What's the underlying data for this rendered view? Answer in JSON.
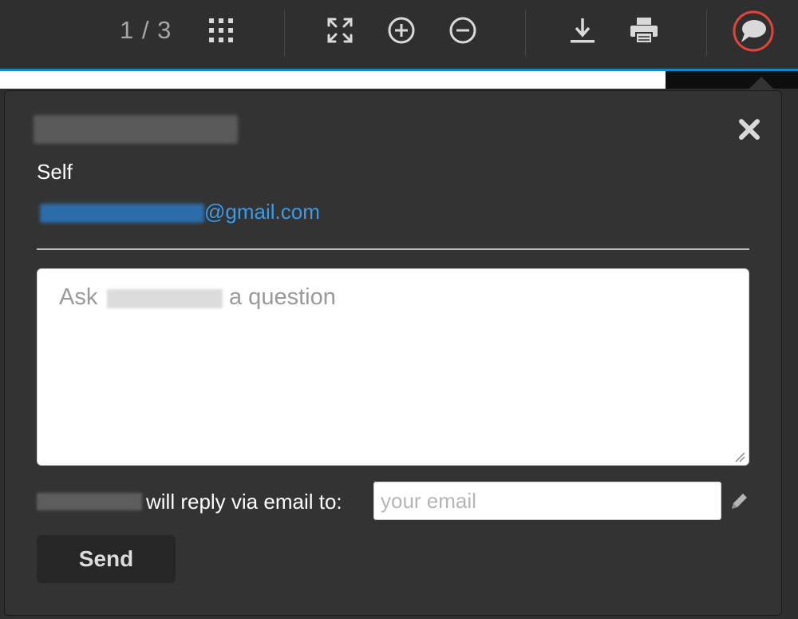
{
  "toolbar": {
    "page_counter": "1 / 3",
    "accent_color": "#0f89c9",
    "buttons": [
      {
        "name": "grid-icon"
      },
      {
        "name": "fullscreen-icon"
      },
      {
        "name": "zoom-in-icon"
      },
      {
        "name": "zoom-out-icon"
      },
      {
        "name": "download-icon"
      },
      {
        "name": "print-icon"
      },
      {
        "name": "comment-icon"
      }
    ],
    "highlight_color": "#e0443b"
  },
  "popover": {
    "relation": "Self",
    "email_visible": "@gmail.com",
    "close_icon": "close-icon",
    "question_prefix": "Ask",
    "question_suffix": "a question",
    "reply_text": "will reply via email to:",
    "email_placeholder": "your email",
    "send_label": "Send",
    "link_color": "#3b9be8"
  }
}
